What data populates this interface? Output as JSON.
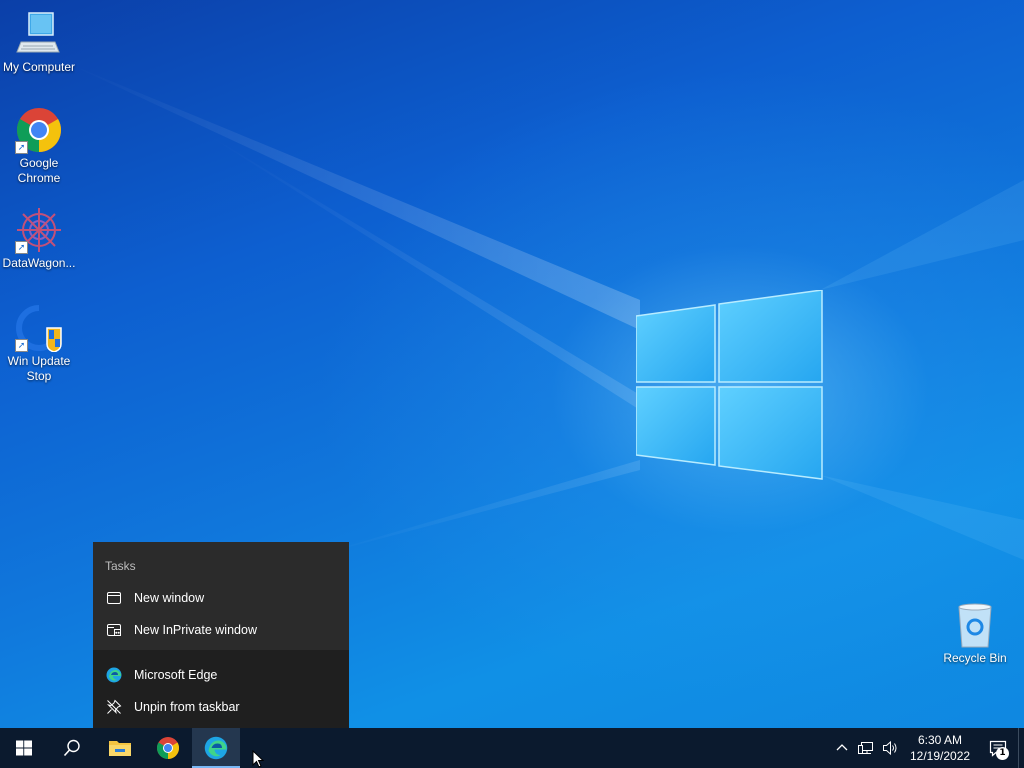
{
  "desktop": {
    "icons": [
      {
        "label": "My Computer"
      },
      {
        "label": "Google Chrome"
      },
      {
        "label": "DataWagon..."
      },
      {
        "label": "Win Update Stop"
      },
      {
        "label": "Recycle Bin"
      }
    ]
  },
  "jumplist": {
    "header": "Tasks",
    "tasks": [
      {
        "label": "New window",
        "icon": "window-icon"
      },
      {
        "label": "New InPrivate window",
        "icon": "inprivate-window-icon"
      }
    ],
    "pinned": [
      {
        "label": "Microsoft Edge",
        "icon": "edge-icon"
      },
      {
        "label": "Unpin from taskbar",
        "icon": "unpin-icon"
      }
    ]
  },
  "taskbar": {
    "apps": [
      "start-icon",
      "search-icon",
      "file-explorer-icon",
      "chrome-icon",
      "edge-icon"
    ],
    "active_app": "edge-icon"
  },
  "tray": {
    "time": "6:30 AM",
    "date": "12/19/2022",
    "notification_count": "1"
  },
  "colors": {
    "taskbar": "#0b1a2e",
    "menu_bg": "#2b2b2b",
    "accent": "#0a74da"
  }
}
